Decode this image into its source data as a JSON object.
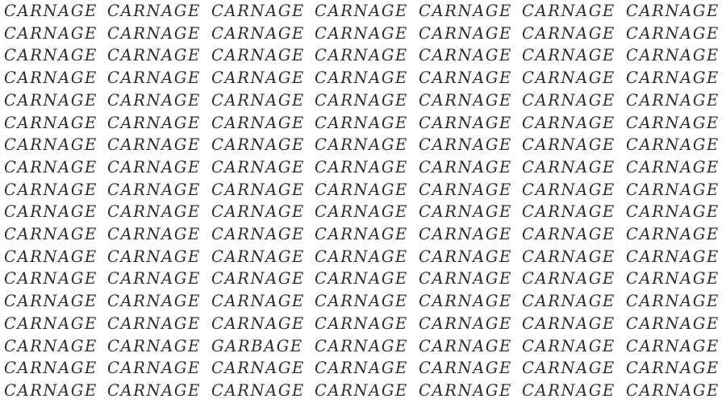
{
  "puzzle": {
    "rows": 18,
    "cols": 7,
    "base_word": "CARNAGE",
    "odd_word": "GARBAGE",
    "odd_position": {
      "row": 16,
      "col": 3
    },
    "grid": [
      [
        "CARNAGE",
        "CARNAGE",
        "CARNAGE",
        "CARNAGE",
        "CARNAGE",
        "CARNAGE",
        "CARNAGE"
      ],
      [
        "CARNAGE",
        "CARNAGE",
        "CARNAGE",
        "CARNAGE",
        "CARNAGE",
        "CARNAGE",
        "CARNAGE"
      ],
      [
        "CARNAGE",
        "CARNAGE",
        "CARNAGE",
        "CARNAGE",
        "CARNAGE",
        "CARNAGE",
        "CARNAGE"
      ],
      [
        "CARNAGE",
        "CARNAGE",
        "CARNAGE",
        "CARNAGE",
        "CARNAGE",
        "CARNAGE",
        "CARNAGE"
      ],
      [
        "CARNAGE",
        "CARNAGE",
        "CARNAGE",
        "CARNAGE",
        "CARNAGE",
        "CARNAGE",
        "CARNAGE"
      ],
      [
        "CARNAGE",
        "CARNAGE",
        "CARNAGE",
        "CARNAGE",
        "CARNAGE",
        "CARNAGE",
        "CARNAGE"
      ],
      [
        "CARNAGE",
        "CARNAGE",
        "CARNAGE",
        "CARNAGE",
        "CARNAGE",
        "CARNAGE",
        "CARNAGE"
      ],
      [
        "CARNAGE",
        "CARNAGE",
        "CARNAGE",
        "CARNAGE",
        "CARNAGE",
        "CARNAGE",
        "CARNAGE"
      ],
      [
        "CARNAGE",
        "CARNAGE",
        "CARNAGE",
        "CARNAGE",
        "CARNAGE",
        "CARNAGE",
        "CARNAGE"
      ],
      [
        "CARNAGE",
        "CARNAGE",
        "CARNAGE",
        "CARNAGE",
        "CARNAGE",
        "CARNAGE",
        "CARNAGE"
      ],
      [
        "CARNAGE",
        "CARNAGE",
        "CARNAGE",
        "CARNAGE",
        "CARNAGE",
        "CARNAGE",
        "CARNAGE"
      ],
      [
        "CARNAGE",
        "CARNAGE",
        "CARNAGE",
        "CARNAGE",
        "CARNAGE",
        "CARNAGE",
        "CARNAGE"
      ],
      [
        "CARNAGE",
        "CARNAGE",
        "CARNAGE",
        "CARNAGE",
        "CARNAGE",
        "CARNAGE",
        "CARNAGE"
      ],
      [
        "CARNAGE",
        "CARNAGE",
        "CARNAGE",
        "CARNAGE",
        "CARNAGE",
        "CARNAGE",
        "CARNAGE"
      ],
      [
        "CARNAGE",
        "CARNAGE",
        "CARNAGE",
        "CARNAGE",
        "CARNAGE",
        "CARNAGE",
        "CARNAGE"
      ],
      [
        "CARNAGE",
        "CARNAGE",
        "GARBAGE",
        "CARNAGE",
        "CARNAGE",
        "CARNAGE",
        "CARNAGE"
      ],
      [
        "CARNAGE",
        "CARNAGE",
        "CARNAGE",
        "CARNAGE",
        "CARNAGE",
        "CARNAGE",
        "CARNAGE"
      ],
      [
        "CARNAGE",
        "CARNAGE",
        "CARNAGE",
        "CARNAGE",
        "CARNAGE",
        "CARNAGE",
        "CARNAGE"
      ]
    ]
  },
  "colors": {
    "background": "#ffffff",
    "text": "#2b2b2b"
  }
}
